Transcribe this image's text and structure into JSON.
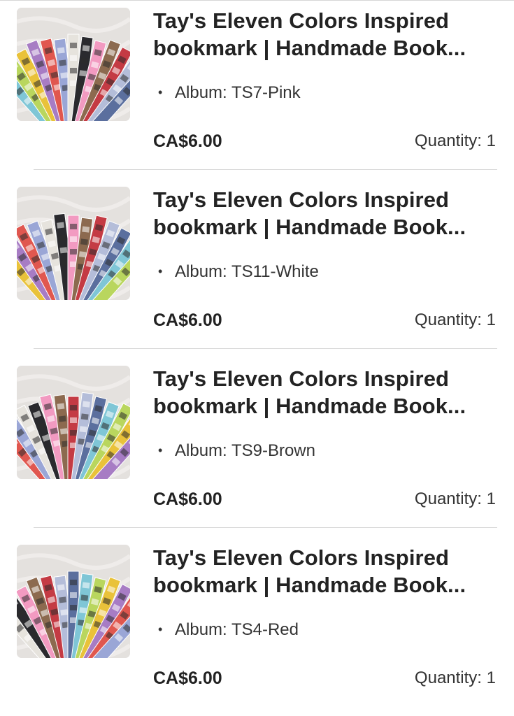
{
  "items": [
    {
      "title_line1": "Tay's Eleven Colors Inspired",
      "title_line2": "bookmark | Handmade Book...",
      "variation_label": "Album:",
      "variation_value": "TS7-Pink",
      "price": "CA$6.00",
      "quantity_label": "Quantity:",
      "quantity": "1"
    },
    {
      "title_line1": "Tay's Eleven Colors Inspired",
      "title_line2": "bookmark | Handmade Book...",
      "variation_label": "Album:",
      "variation_value": "TS11-White",
      "price": "CA$6.00",
      "quantity_label": "Quantity:",
      "quantity": "1"
    },
    {
      "title_line1": "Tay's Eleven Colors Inspired",
      "title_line2": "bookmark | Handmade Book...",
      "variation_label": "Album:",
      "variation_value": "TS9-Brown",
      "price": "CA$6.00",
      "quantity_label": "Quantity:",
      "quantity": "1"
    },
    {
      "title_line1": "Tay's Eleven Colors Inspired",
      "title_line2": "bookmark | Handmade Book...",
      "variation_label": "Album:",
      "variation_value": "TS4-Red",
      "price": "CA$6.00",
      "quantity_label": "Quantity:",
      "quantity": "1"
    }
  ],
  "thumbnail_icon": "bookmark-fan-photo",
  "bookmark_colors": [
    "#7fc6d6",
    "#b9d65e",
    "#e9c23a",
    "#a77cc4",
    "#e0574f",
    "#9aa6d6",
    "#e6e3dd",
    "#2a2a2e",
    "#f29ac1",
    "#8c6a4f",
    "#c43b44",
    "#b4bdd9",
    "#5b6f9e"
  ],
  "backdrop_color": "#e4e1de",
  "text_color": "#222222",
  "divider_color": "#d9d9d9"
}
